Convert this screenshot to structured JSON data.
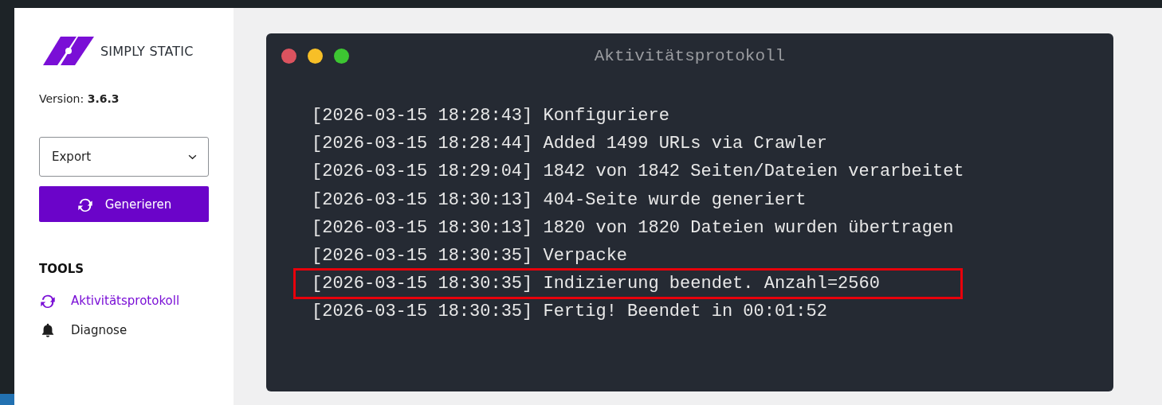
{
  "sidebar": {
    "logo_text": "SIMPLY STATIC",
    "version_label": "Version:",
    "version": "3.6.3",
    "select": {
      "value": "Export"
    },
    "generate_button": "Generieren",
    "tools_heading": "TOOLS",
    "items": [
      {
        "label": "Aktivitätsprotokoll",
        "selected": true,
        "kind": "sync"
      },
      {
        "label": "Diagnose",
        "selected": false,
        "kind": "bell"
      }
    ]
  },
  "terminal": {
    "title": "Aktivitätsprotokoll",
    "lines": [
      {
        "time": "[2026-03-15 18:28:43]",
        "message": "Konfiguriere",
        "highlighted": false
      },
      {
        "time": "[2026-03-15 18:28:44]",
        "message": "Added 1499 URLs via Crawler",
        "highlighted": false
      },
      {
        "time": "[2026-03-15 18:29:04]",
        "message": "1842 von 1842 Seiten/Dateien verarbeitet",
        "highlighted": false
      },
      {
        "time": "[2026-03-15 18:30:13]",
        "message": "404-Seite wurde generiert",
        "highlighted": false
      },
      {
        "time": "[2026-03-15 18:30:13]",
        "message": "1820 von 1820 Dateien wurden übertragen",
        "highlighted": false
      },
      {
        "time": "[2026-03-15 18:30:35]",
        "message": "Verpacke",
        "highlighted": false
      },
      {
        "time": "[2026-03-15 18:30:35]",
        "message": "Indizierung beendet. Anzahl=2560",
        "highlighted": true
      },
      {
        "time": "[2026-03-15 18:30:35]",
        "message": "Fertig! Beendet in 00:01:52",
        "highlighted": false
      }
    ]
  }
}
